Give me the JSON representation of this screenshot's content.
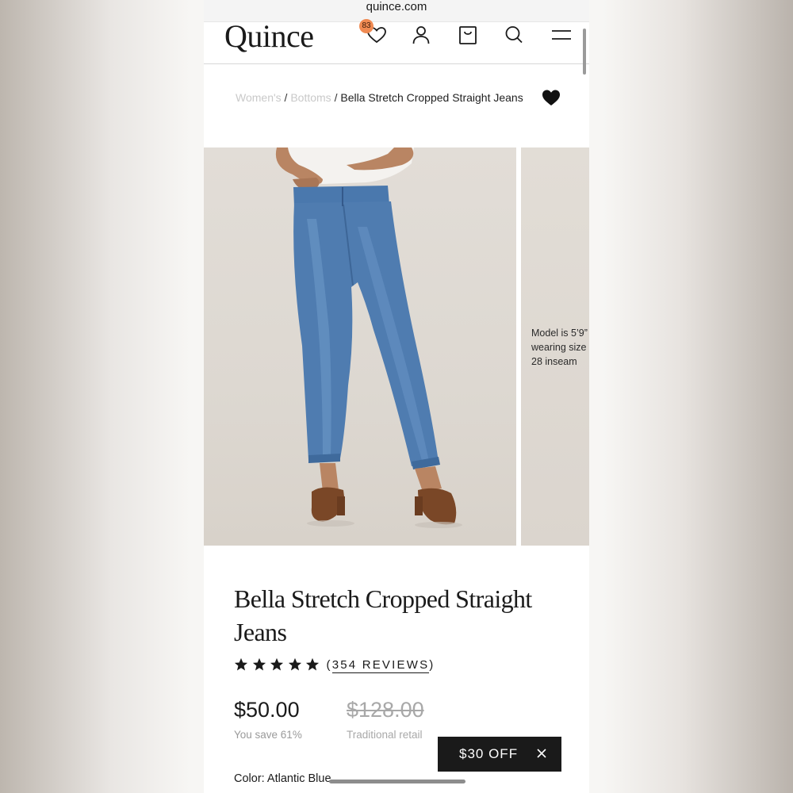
{
  "browser": {
    "url": "quince.com"
  },
  "header": {
    "logo": "Quince",
    "wishlist_count": "83",
    "icons": [
      "heart-icon",
      "account-icon",
      "bag-icon",
      "search-icon",
      "menu-icon"
    ]
  },
  "breadcrumb": {
    "items": [
      "Women's",
      "Bottoms"
    ],
    "separator": "/",
    "current": "Bella Stretch Cropped Straight Jeans"
  },
  "gallery": {
    "model_note": "Model is 5’9”\nwearing size\n28 inseam"
  },
  "product": {
    "title": "Bella Stretch Cropped Straight Jeans",
    "rating_stars": 5,
    "reviews_label": "354 REVIEWS",
    "reviews_open": "(",
    "reviews_close": ")",
    "price": "$50.00",
    "savings": "You save 61%",
    "original_price": "$128.00",
    "original_label": "Traditional retail",
    "color_label": "Color: Atlantic Blue"
  },
  "promo": {
    "label": "$30 OFF"
  },
  "colors": {
    "badge": "#f08a52",
    "promo_bg": "#1a1a1a",
    "denim": "#4f7cb0"
  }
}
